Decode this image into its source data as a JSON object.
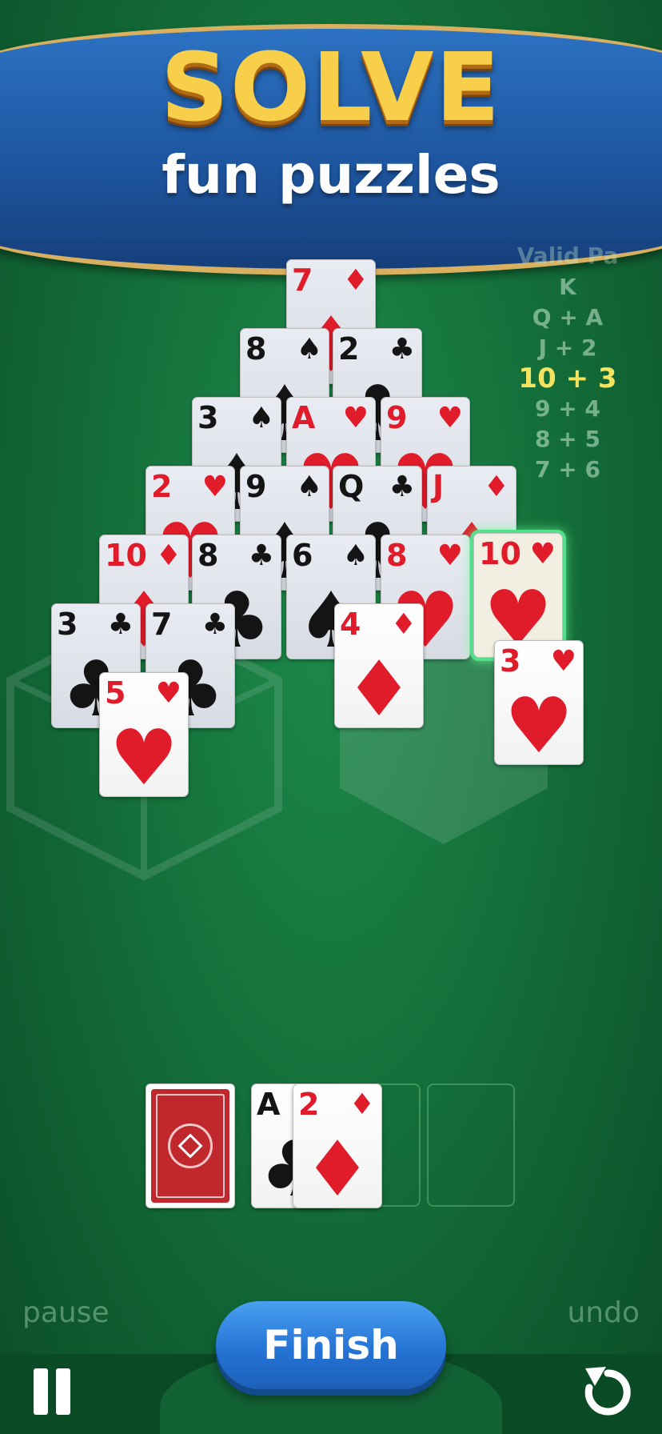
{
  "banner": {
    "title": "SOLVE",
    "subtitle": "fun puzzles"
  },
  "valid_pairs": {
    "heading": "Valid Pa",
    "rows": [
      "K",
      "Q + A",
      "J + 2",
      "10 + 3",
      "9 + 4",
      "8 + 5",
      "7 + 6"
    ],
    "active_index": 3
  },
  "pyramid": {
    "rows": [
      [
        {
          "rank": "7",
          "suit": "♦",
          "color": "red"
        }
      ],
      [
        {
          "rank": "8",
          "suit": "♠",
          "color": "black"
        },
        {
          "rank": "2",
          "suit": "♣",
          "color": "black"
        }
      ],
      [
        {
          "rank": "3",
          "suit": "♠",
          "color": "black"
        },
        {
          "rank": "A",
          "suit": "♥",
          "color": "red"
        },
        {
          "rank": "9",
          "suit": "♥",
          "color": "red"
        }
      ],
      [
        {
          "rank": "2",
          "suit": "♥",
          "color": "red"
        },
        {
          "rank": "9",
          "suit": "♠",
          "color": "black"
        },
        {
          "rank": "Q",
          "suit": "♣",
          "color": "black"
        },
        {
          "rank": "J",
          "suit": "♦",
          "color": "red"
        }
      ],
      [
        {
          "rank": "10",
          "suit": "♦",
          "color": "red"
        },
        {
          "rank": "8",
          "suit": "♣",
          "color": "black"
        },
        {
          "rank": "6",
          "suit": "♠",
          "color": "black"
        },
        {
          "rank": "8",
          "suit": "♥",
          "color": "red"
        },
        {
          "rank": "10",
          "suit": "♥",
          "color": "red"
        }
      ],
      [
        {
          "rank": "3",
          "suit": "♣",
          "color": "black"
        },
        {
          "rank": "7",
          "suit": "♣",
          "color": "black"
        }
      ]
    ]
  },
  "loose_cards": [
    {
      "rank": "5",
      "suit": "♥",
      "color": "red"
    },
    {
      "rank": "4",
      "suit": "♦",
      "color": "red"
    },
    {
      "rank": "3",
      "suit": "♥",
      "color": "red"
    }
  ],
  "waste": [
    {
      "rank": "A",
      "suit": "♣",
      "color": "black"
    },
    {
      "rank": "2",
      "suit": "♦",
      "color": "red"
    }
  ],
  "controls": {
    "pause_label": "pause",
    "undo_label": "undo",
    "finish_label": "Finish"
  },
  "colors": {
    "table_green": "#14703a",
    "banner_blue": "#1e56a0",
    "title_gold": "#f7cf4a",
    "suit_red": "#e01b2a",
    "highlight_green": "#53e08a",
    "finish_blue": "#2574d6"
  }
}
